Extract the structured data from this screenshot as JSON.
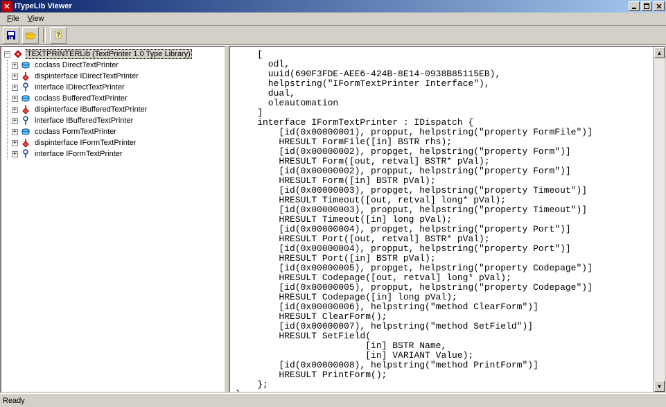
{
  "title": "ITypeLib Viewer",
  "menus": {
    "file": "File",
    "view": "View"
  },
  "toolbar": {
    "save": "Save",
    "open": "Open",
    "help": "Help"
  },
  "status": "Ready",
  "tree": {
    "root": "TEXTPRINTERLib (TextPrinter 1.0 Type Library)",
    "items": [
      "coclass DirectTextPrinter",
      "dispinterface IDirectTextPrinter",
      "interface IDirectTextPrinter",
      "coclass BufferedTextPrinter",
      "dispinterface IBufferedTextPrinter",
      "interface IBufferedTextPrinter",
      "coclass FormTextPrinter",
      "dispinterface IFormTextPrinter",
      "interface IFormTextPrinter"
    ]
  },
  "idl": "    [\n      odl,\n      uuid(690F3FDE-AEE6-424B-8E14-0938B85115EB),\n      helpstring(\"IFormTextPrinter Interface\"),\n      dual,\n      oleautomation\n    ]\n    interface IFormTextPrinter : IDispatch {\n        [id(0x00000001), propput, helpstring(\"property FormFile\")]\n        HRESULT FormFile([in] BSTR rhs);\n        [id(0x00000002), propget, helpstring(\"property Form\")]\n        HRESULT Form([out, retval] BSTR* pVal);\n        [id(0x00000002), propput, helpstring(\"property Form\")]\n        HRESULT Form([in] BSTR pVal);\n        [id(0x00000003), propget, helpstring(\"property Timeout\")]\n        HRESULT Timeout([out, retval] long* pVal);\n        [id(0x00000003), propput, helpstring(\"property Timeout\")]\n        HRESULT Timeout([in] long pVal);\n        [id(0x00000004), propget, helpstring(\"property Port\")]\n        HRESULT Port([out, retval] BSTR* pVal);\n        [id(0x00000004), propput, helpstring(\"property Port\")]\n        HRESULT Port([in] BSTR pVal);\n        [id(0x00000005), propget, helpstring(\"property Codepage\")]\n        HRESULT Codepage([out, retval] long* pVal);\n        [id(0x00000005), propput, helpstring(\"property Codepage\")]\n        HRESULT Codepage([in] long pVal);\n        [id(0x00000006), helpstring(\"method ClearForm\")]\n        HRESULT ClearForm();\n        [id(0x00000007), helpstring(\"method SetField\")]\n        HRESULT SetField(\n                        [in] BSTR Name, \n                        [in] VARIANT Value);\n        [id(0x00000008), helpstring(\"method PrintForm\")]\n        HRESULT PrintForm();\n    };\n};"
}
